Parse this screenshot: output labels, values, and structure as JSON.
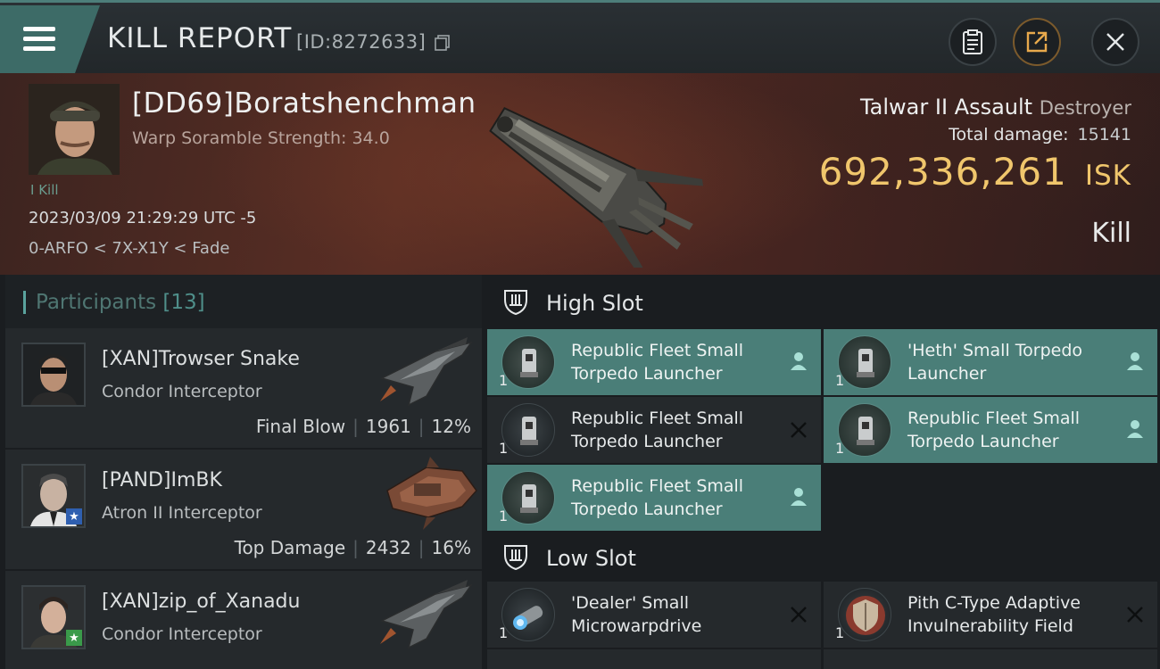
{
  "header": {
    "title": "KILL REPORT",
    "id_text": "[ID:8272633]"
  },
  "victim": {
    "name": "[DD69]Boratshenchman",
    "scramble": "Warp Soramble Strength: 34.0",
    "kills": "I Kill",
    "datetime": "2023/03/09 21:29:29 UTC -5",
    "location": "0-ARFO < 7X-X1Y < Fade",
    "ship_name": "Talwar II Assault",
    "ship_class": "Destroyer",
    "damage_label": "Total damage:",
    "damage_value": "15141",
    "isk_value": "692,336,261",
    "isk_unit": "ISK",
    "result": "Kill"
  },
  "participants": {
    "label": "Participants",
    "count": "[13]",
    "rows": [
      {
        "name": "[XAN]Trowser Snake",
        "ship": "Condor Interceptor",
        "role": "Final Blow",
        "damage": "1961",
        "percent": "12%"
      },
      {
        "name": "[PAND]ImBK",
        "ship": "Atron II Interceptor",
        "role": "Top Damage",
        "damage": "2432",
        "percent": "16%"
      },
      {
        "name": "[XAN]zip_of_Xanadu",
        "ship": "Condor Interceptor",
        "role": "",
        "damage": "",
        "percent": ""
      }
    ]
  },
  "high_slot": {
    "label": "High Slot",
    "modules": [
      {
        "line1": "Republic Fleet Small",
        "line2": "Torpedo Launcher",
        "qty": "1",
        "state": "dropped"
      },
      {
        "line1": "'Heth' Small Torpedo",
        "line2": "Launcher",
        "qty": "1",
        "state": "dropped"
      },
      {
        "line1": "Republic Fleet Small",
        "line2": "Torpedo Launcher",
        "qty": "1",
        "state": "destroyed"
      },
      {
        "line1": "Republic Fleet Small",
        "line2": "Torpedo Launcher",
        "qty": "1",
        "state": "dropped"
      },
      {
        "line1": "Republic Fleet Small",
        "line2": "Torpedo Launcher",
        "qty": "1",
        "state": "dropped"
      }
    ]
  },
  "low_slot": {
    "label": "Low Slot",
    "modules": [
      {
        "line1": "'Dealer' Small",
        "line2": "Microwarpdrive",
        "qty": "1",
        "state": "destroyed"
      },
      {
        "line1": "Pith C-Type Adaptive",
        "line2": "Invulnerability Field",
        "qty": "1",
        "state": "destroyed"
      }
    ]
  },
  "colors": {
    "accent": "#4a7e78",
    "isk": "#f0c66c",
    "banner": "#5a2e24"
  }
}
